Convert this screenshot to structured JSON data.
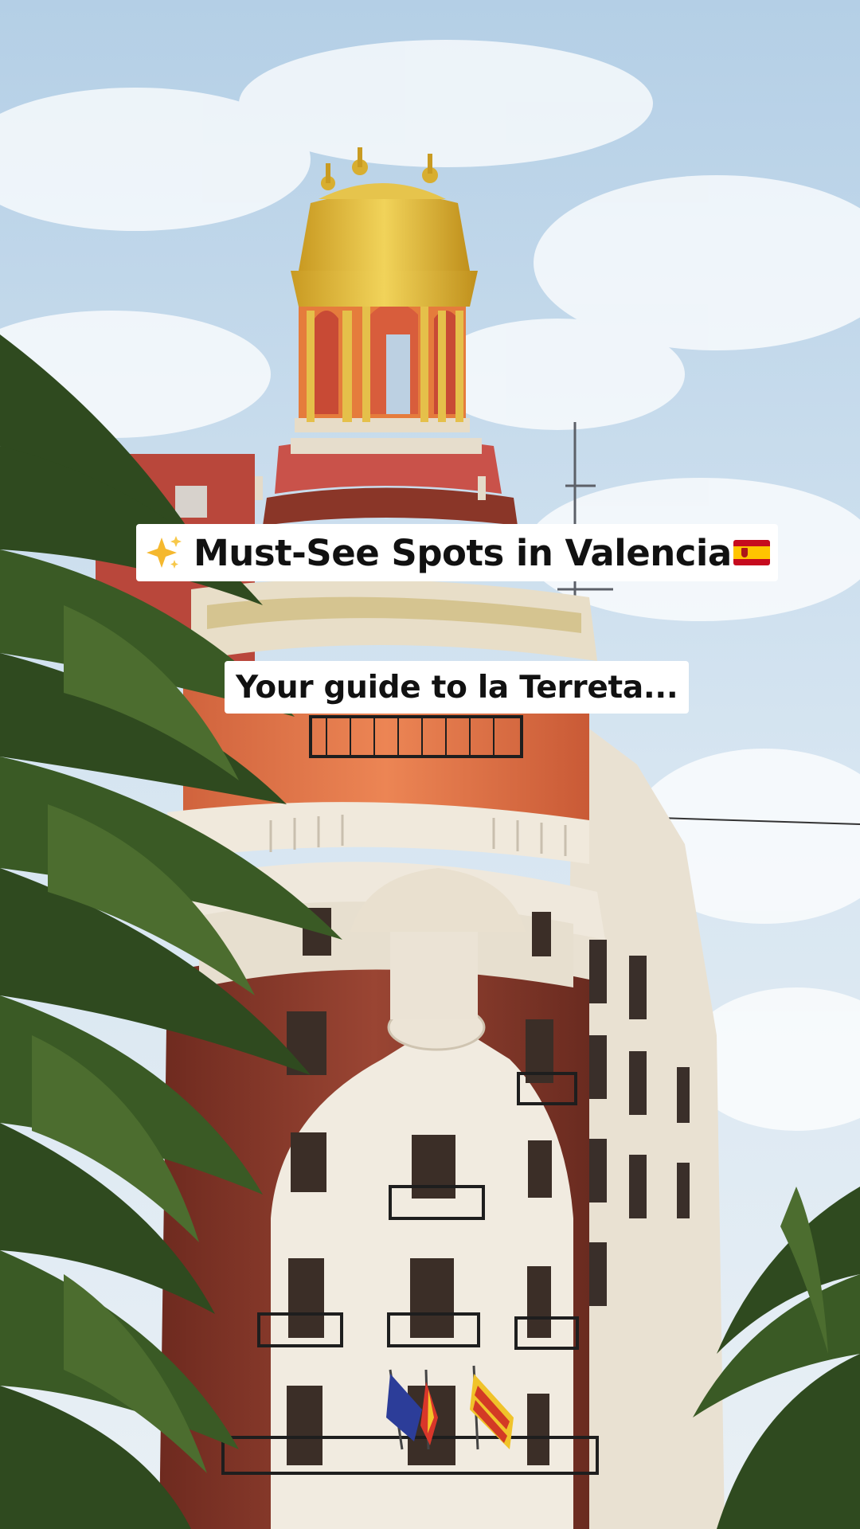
{
  "post": {
    "title": {
      "icon_left": "sparkles-icon",
      "text": "Must-See Spots in Valencia",
      "icon_right": "spain-flag-icon"
    },
    "subtitle": "Your guide to la Terreta..."
  },
  "colors": {
    "sky": "#c9dced",
    "caption_background": "#ffffff",
    "caption_text": "#111111",
    "dome": "#e0bb3a",
    "facade_brick": "#8a3a2c",
    "facade_stone": "#efe8dc",
    "palm": "#2e4a1e"
  }
}
